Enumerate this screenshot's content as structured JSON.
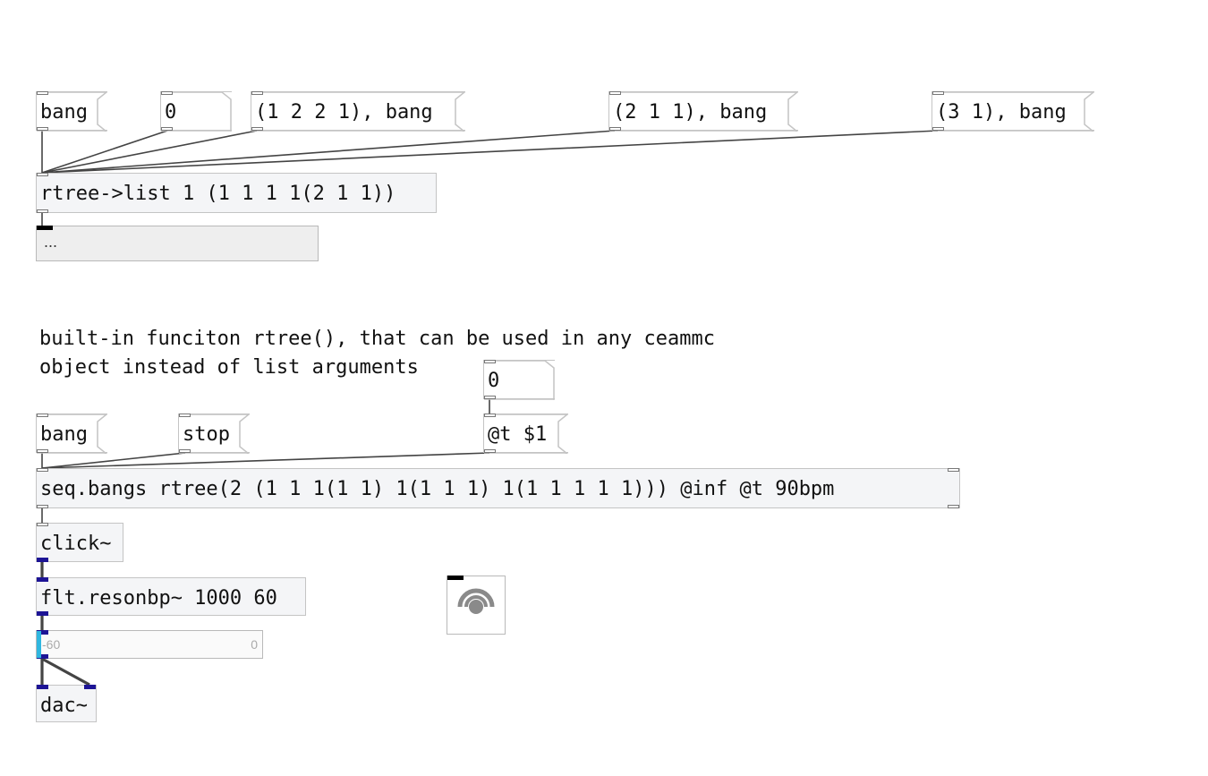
{
  "patch": {
    "msg_bang_1": "bang",
    "msg_zero_1": "0",
    "msg_tree_a": "(1 2 2 1), bang",
    "msg_tree_b": "(2 1 1), bang",
    "msg_tree_c": "(3 1), bang",
    "obj_rtree_list": "rtree->list 1 (1 1 1 1(2 1 1))",
    "list_view_value": "...",
    "comment_line_1": "built-in funciton rtree(), that can be used in any ceammc",
    "comment_line_2": "object instead of list arguments",
    "msg_zero_2": "0",
    "msg_bang_2": "bang",
    "msg_stop": "stop",
    "msg_set_tempo": "@t $1",
    "obj_seq_bangs": "seq.bangs rtree(2 (1 1 1(1 1) 1(1 1 1) 1(1 1 1 1 1))) @inf @t 90bpm",
    "obj_click": "click~",
    "obj_resonbp": "flt.resonbp~ 1000 60",
    "meter_min": "-60",
    "meter_max": "0",
    "meter_level": 0.02,
    "obj_dac": "dac~",
    "dsp_icon": "speaker-dsp-toggle-icon"
  },
  "colors": {
    "signal_cord": "#1d1495",
    "control_cord": "#444444",
    "meter_fill": "#30b7e0"
  }
}
